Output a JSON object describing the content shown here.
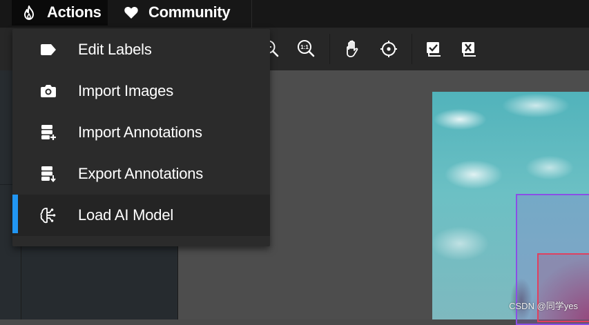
{
  "top_menu": {
    "actions": {
      "label": "Actions",
      "icon": "flame-icon"
    },
    "community": {
      "label": "Community",
      "icon": "heart-icon"
    }
  },
  "toolbar": {
    "tools": [
      {
        "name": "zoom-out-icon"
      },
      {
        "name": "zoom-actual-size-icon",
        "text": "1:1"
      },
      {
        "name": "hand-pan-icon"
      },
      {
        "name": "crosshair-icon"
      },
      {
        "name": "accept-all-icon"
      },
      {
        "name": "reject-all-icon"
      }
    ]
  },
  "actions_menu": {
    "items": [
      {
        "label": "Edit Labels",
        "icon": "label-tag-icon"
      },
      {
        "label": "Import Images",
        "icon": "camera-icon"
      },
      {
        "label": "Import Annotations",
        "icon": "database-plus-icon"
      },
      {
        "label": "Export Annotations",
        "icon": "database-export-icon"
      },
      {
        "label": "Load AI Model",
        "icon": "ai-brain-icon",
        "highlighted": true
      }
    ]
  },
  "canvas": {
    "annotation_colors": {
      "box1": "#8a4fe6",
      "box2": "#e0405e"
    }
  },
  "watermark": "CSDN @同学yes",
  "colors": {
    "accent": "#2196f3",
    "topbar": "#171717",
    "menu_bg": "#2b2b2b"
  }
}
